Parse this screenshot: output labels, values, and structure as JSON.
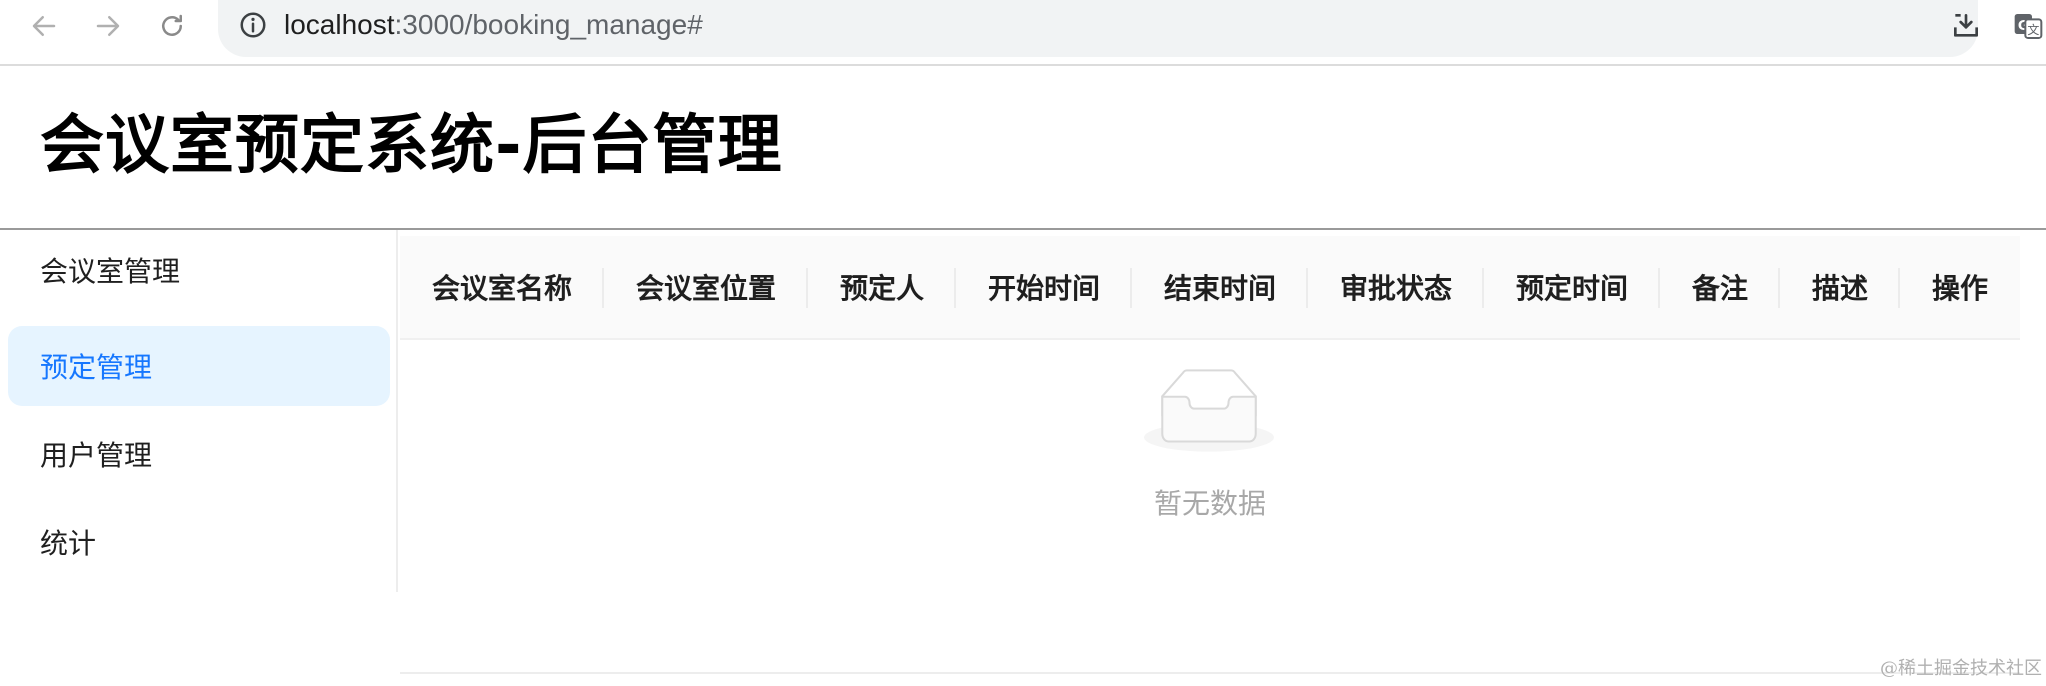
{
  "browser": {
    "url_host": "localhost",
    "url_rest": ":3000/booking_manage#"
  },
  "header": {
    "title": "会议室预定系统-后台管理"
  },
  "sidebar": {
    "items": [
      {
        "label": "会议室管理",
        "selected": false
      },
      {
        "label": "预定管理",
        "selected": true
      },
      {
        "label": "用户管理",
        "selected": false
      },
      {
        "label": "统计",
        "selected": false
      }
    ]
  },
  "table": {
    "columns": [
      "会议室名称",
      "会议室位置",
      "预定人",
      "开始时间",
      "结束时间",
      "审批状态",
      "预定时间",
      "备注",
      "描述",
      "操作"
    ],
    "rows": [],
    "empty_text": "暂无数据"
  },
  "watermark": "@稀土掘金技术社区",
  "colors": {
    "accent": "#1677ff",
    "selected_bg": "#e6f4ff",
    "header_bg": "#fafafa"
  }
}
